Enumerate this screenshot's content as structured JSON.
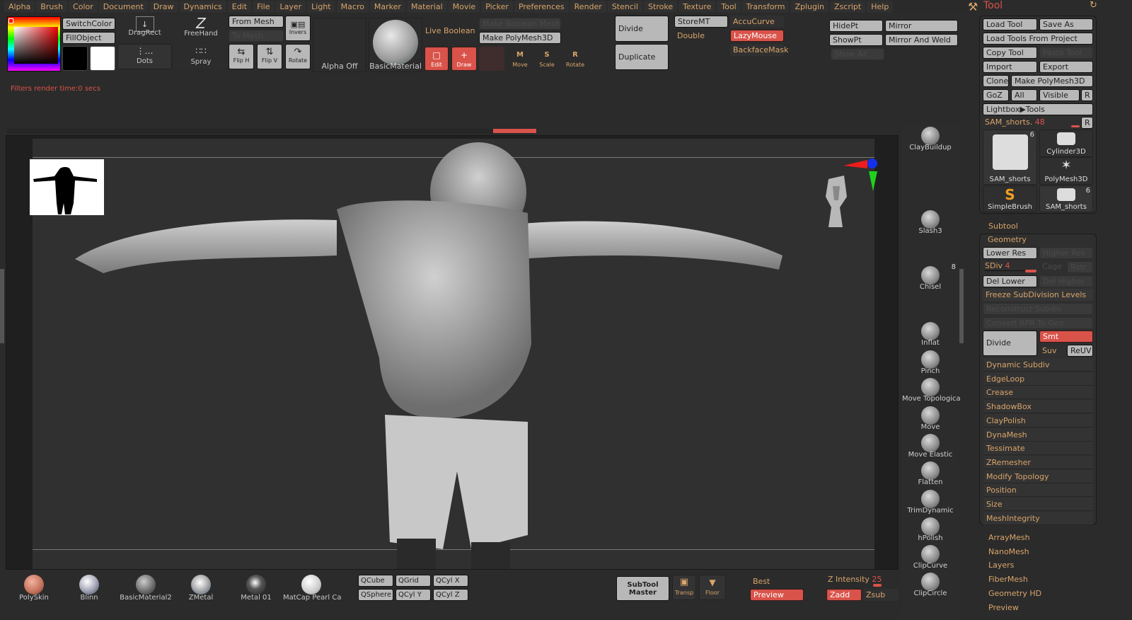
{
  "menu": [
    "Alpha",
    "Brush",
    "Color",
    "Document",
    "Draw",
    "Dynamics",
    "Edit",
    "File",
    "Layer",
    "Light",
    "Macro",
    "Marker",
    "Material",
    "Movie",
    "Picker",
    "Preferences",
    "Render",
    "Stencil",
    "Stroke",
    "Texture",
    "Tool",
    "Transform",
    "Zplugin",
    "Zscript",
    "Help"
  ],
  "top_shelf": {
    "switch_color": "SwitchColor",
    "fill_object": "FillObject",
    "drag_rect": "DragRect",
    "dots": "Dots",
    "freehand": "FreeHand",
    "spray": "Spray",
    "from_mesh": "From Mesh",
    "to_mesh": "To Mesh",
    "invers": "Invers",
    "flip_h": "Flip H",
    "flip_v": "Flip V",
    "rotate": "Rotate",
    "alpha_off": "Alpha Off",
    "basic_material": "BasicMaterial",
    "live_boolean": "Live Boolean",
    "make_boolean_mesh": "Make Boolean Mesh",
    "make_polymesh3d": "Make PolyMesh3D",
    "edit": "Edit",
    "draw": "Draw",
    "move": "Move",
    "scale": "Scale",
    "rotate2": "Rotate",
    "divide": "Divide",
    "duplicate": "Duplicate",
    "store_mt": "StoreMT",
    "double": "Double",
    "accucurve": "AccuCurve",
    "lazymouse": "LazyMouse",
    "backfacemask": "BackfaceMask",
    "hidept": "HidePt",
    "showpt": "ShowPt",
    "show_all": "Show All",
    "mirror": "Mirror",
    "mirror_and_weld": "Mirror And Weld"
  },
  "status": {
    "filters_render": "Filters render time:0 secs"
  },
  "brushes": [
    {
      "name": "ClayBuildup",
      "count": ""
    },
    {
      "name": "Slash3",
      "count": ""
    },
    {
      "name": "Chisel",
      "count": "8"
    },
    {
      "name": "Inflat",
      "count": ""
    },
    {
      "name": "Pinch",
      "count": ""
    },
    {
      "name": "Move Topologica",
      "count": ""
    },
    {
      "name": "Move",
      "count": ""
    },
    {
      "name": "Move Elastic",
      "count": ""
    },
    {
      "name": "Flatten",
      "count": ""
    },
    {
      "name": "TrimDynamic",
      "count": ""
    },
    {
      "name": "hPolish",
      "count": ""
    },
    {
      "name": "ClipCurve",
      "count": ""
    },
    {
      "name": "ClipCircle",
      "count": ""
    }
  ],
  "tool_panel": {
    "title": "Tool",
    "load_tool": "Load Tool",
    "save_as": "Save As",
    "load_tools_from_project": "Load Tools From Project",
    "copy_tool": "Copy Tool",
    "paste_tool": "Paste Tool",
    "import": "Import",
    "export": "Export",
    "clone": "Clone",
    "make_polymesh3d": "Make PolyMesh3D",
    "goz": "GoZ",
    "all": "All",
    "visible": "Visible",
    "r": "R",
    "lightbox_tools": "Lightbox▶Tools",
    "current_tool": "SAM_shorts.",
    "current_tool_value": "48",
    "thumbs": [
      {
        "name": "SAM_shorts",
        "count": "6"
      },
      {
        "name": "Cylinder3D",
        "count": ""
      },
      {
        "name": "PolyMesh3D",
        "count": ""
      },
      {
        "name": "SimpleBrush",
        "count": ""
      },
      {
        "name": "SAM_shorts",
        "count": "6"
      }
    ],
    "subtool": "Subtool",
    "geometry": "Geometry",
    "lower_res": "Lower Res",
    "higher_res": "Higher Res",
    "sdiv_label": "SDiv",
    "sdiv_value": "4",
    "cage": "Cage",
    "rstr": "Rstr",
    "del_lower": "Del Lower",
    "del_higher": "Del Higher",
    "freeze_subdiv": "Freeze SubDivision Levels",
    "reconstruct_subdiv": "Reconstruct Subdiv",
    "convert_bpr": "Convert BPR To Geo",
    "divide": "Divide",
    "smt": "Smt",
    "suv": "Suv",
    "reuv": "ReUV",
    "geometry_items": [
      "Dynamic Subdiv",
      "EdgeLoop",
      "Crease",
      "ShadowBox",
      "ClayPolish",
      "DynaMesh",
      "Tessimate",
      "ZRemesher",
      "Modify Topology",
      "Position",
      "Size",
      "MeshIntegrity"
    ],
    "sections": [
      "ArrayMesh",
      "NanoMesh",
      "Layers",
      "FiberMesh",
      "Geometry HD",
      "Preview"
    ]
  },
  "materials": [
    "PolySkin",
    "Blinn",
    "BasicMaterial2",
    "ZMetal",
    "Metal 01",
    "MatCap Pearl Ca"
  ],
  "quick": [
    "QCube",
    "QGrid",
    "QCyl X",
    "QSphere",
    "QCyl Y",
    "QCyl Z"
  ],
  "bottom": {
    "subtool_master_1": "SubTool",
    "subtool_master_2": "Master",
    "transp": "Transp",
    "floor": "Floor",
    "best": "Best",
    "preview": "Preview",
    "z_intensity_label": "Z Intensity",
    "z_intensity_value": "25",
    "zadd": "Zadd",
    "zsub": "Zsub"
  },
  "colors": {
    "accent": "#d9534a",
    "label": "#d9a56b"
  }
}
